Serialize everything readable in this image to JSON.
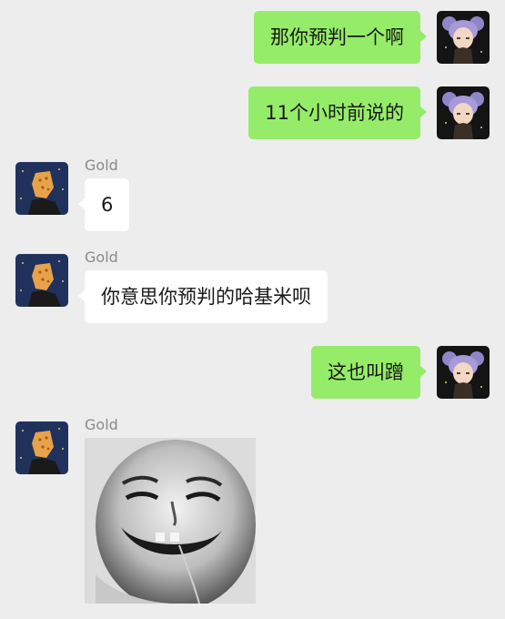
{
  "contact": {
    "name": "Gold"
  },
  "messages": [
    {
      "id": 1,
      "from": "me",
      "text": "那你预判一个啊"
    },
    {
      "id": 2,
      "from": "me",
      "text": "11个小时前说的"
    },
    {
      "id": 3,
      "from": "other",
      "sender": "Gold",
      "text": "6"
    },
    {
      "id": 4,
      "from": "other",
      "sender": "Gold",
      "text": "你意思你预判的哈基米呗"
    },
    {
      "id": 5,
      "from": "me",
      "text": "这也叫蹭"
    },
    {
      "id": 6,
      "from": "other",
      "sender": "Gold",
      "type": "image",
      "image_subject": "laughing-baby-meme"
    }
  ],
  "colors": {
    "background": "#ededed",
    "my_bubble": "#95ec69",
    "other_bubble": "#ffffff",
    "sender_name": "#8a8a8a",
    "text": "#191919"
  }
}
